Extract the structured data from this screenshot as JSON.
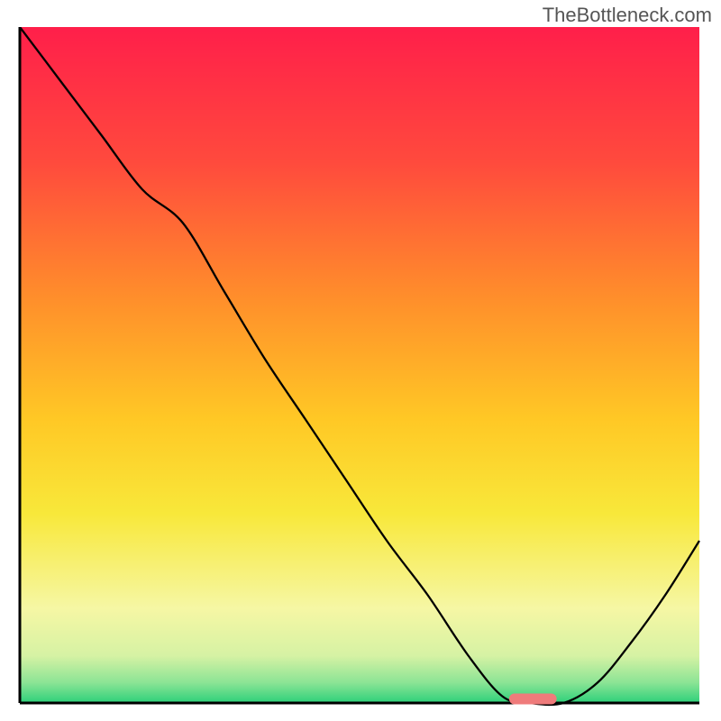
{
  "watermark": "TheBottleneck.com",
  "chart_data": {
    "type": "line",
    "xlim": [
      0,
      100
    ],
    "ylim": [
      0,
      100
    ],
    "series": [
      {
        "name": "curve",
        "x": [
          0,
          6,
          12,
          18,
          24,
          30,
          36,
          42,
          48,
          54,
          60,
          66,
          71,
          75,
          80,
          85,
          90,
          95,
          100
        ],
        "values": [
          100,
          92,
          84,
          76,
          71,
          61,
          51,
          42,
          33,
          24,
          16,
          7,
          1,
          0,
          0,
          3,
          9,
          16,
          24
        ]
      }
    ],
    "marker": {
      "x_start": 72,
      "x_end": 79,
      "y": 0.6
    },
    "gradient_stops": [
      {
        "offset": 0,
        "color": "#ff1f4a"
      },
      {
        "offset": 20,
        "color": "#ff4a3d"
      },
      {
        "offset": 40,
        "color": "#ff8e2b"
      },
      {
        "offset": 58,
        "color": "#ffc825"
      },
      {
        "offset": 72,
        "color": "#f8e83a"
      },
      {
        "offset": 86,
        "color": "#f6f7a4"
      },
      {
        "offset": 93,
        "color": "#d6f2a4"
      },
      {
        "offset": 97,
        "color": "#8be495"
      },
      {
        "offset": 100,
        "color": "#2dd07a"
      }
    ],
    "axis_color": "#000000"
  }
}
